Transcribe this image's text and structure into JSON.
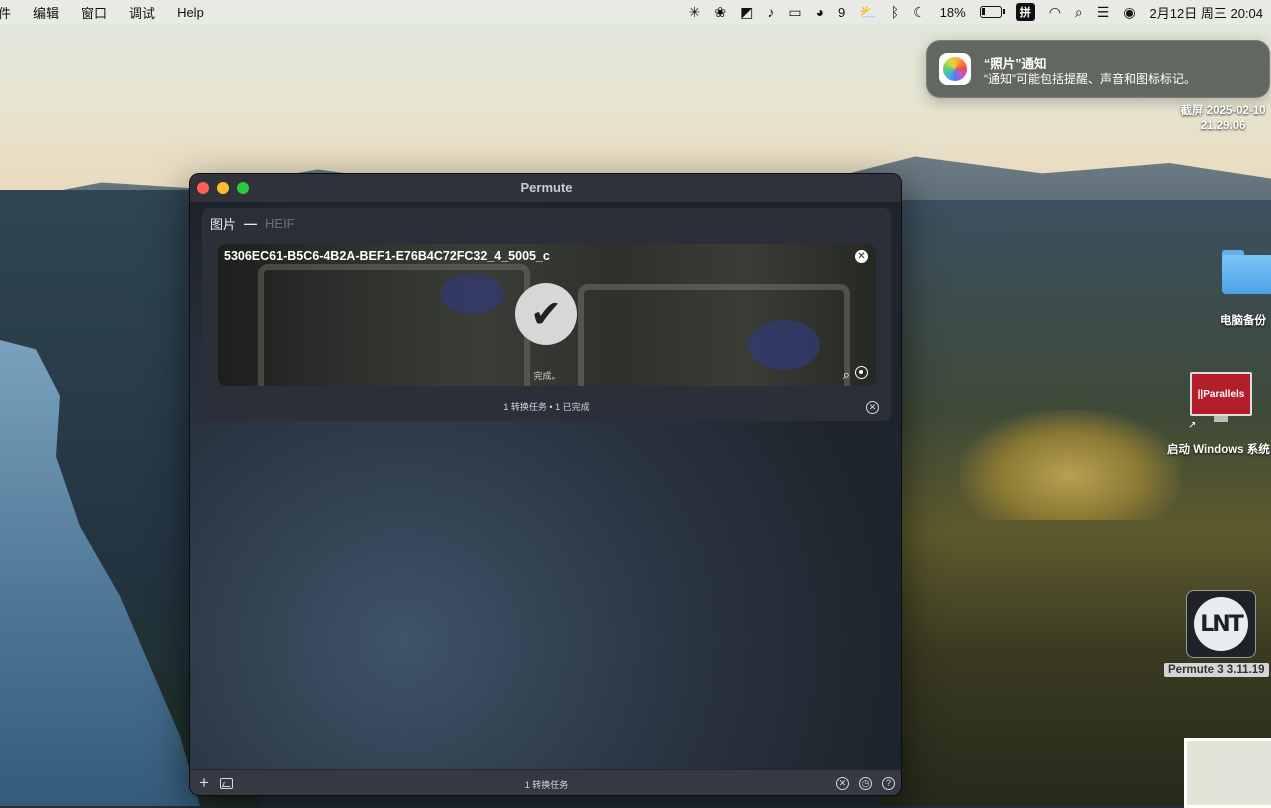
{
  "menubar": {
    "items": [
      "件",
      "编辑",
      "窗口",
      "调试",
      "Help"
    ],
    "wechat_count": "9",
    "battery_percent": "18%",
    "battery_level": 0.18,
    "input_method": "拼",
    "datetime": "2月12日 周三  20:04"
  },
  "notification": {
    "title": "“照片”通知",
    "body": "“通知”可能包括提醒、声音和图标标记。"
  },
  "desktop": {
    "screenshot_label_line1": "截屏 2025-02-10",
    "screenshot_label_line2": "21.29.06",
    "backup_folder_label": "电脑备份",
    "parallels_icon_text": "||Parallels",
    "parallels_label": "启动 Windows 系统",
    "permute_icon_text": "LNT",
    "permute_label": "Permute 3 3.11.19"
  },
  "window": {
    "title": "Permute",
    "group": {
      "type": "图片",
      "format": "HEIF",
      "item_name": "5306EC61-B5C6-4B2A-BEF1-E76B4C72FC32_4_5005_c",
      "item_status": "完成。",
      "summary": "1 转换任务 • 1 已完成"
    },
    "bottom_summary": "1 转换任务"
  }
}
